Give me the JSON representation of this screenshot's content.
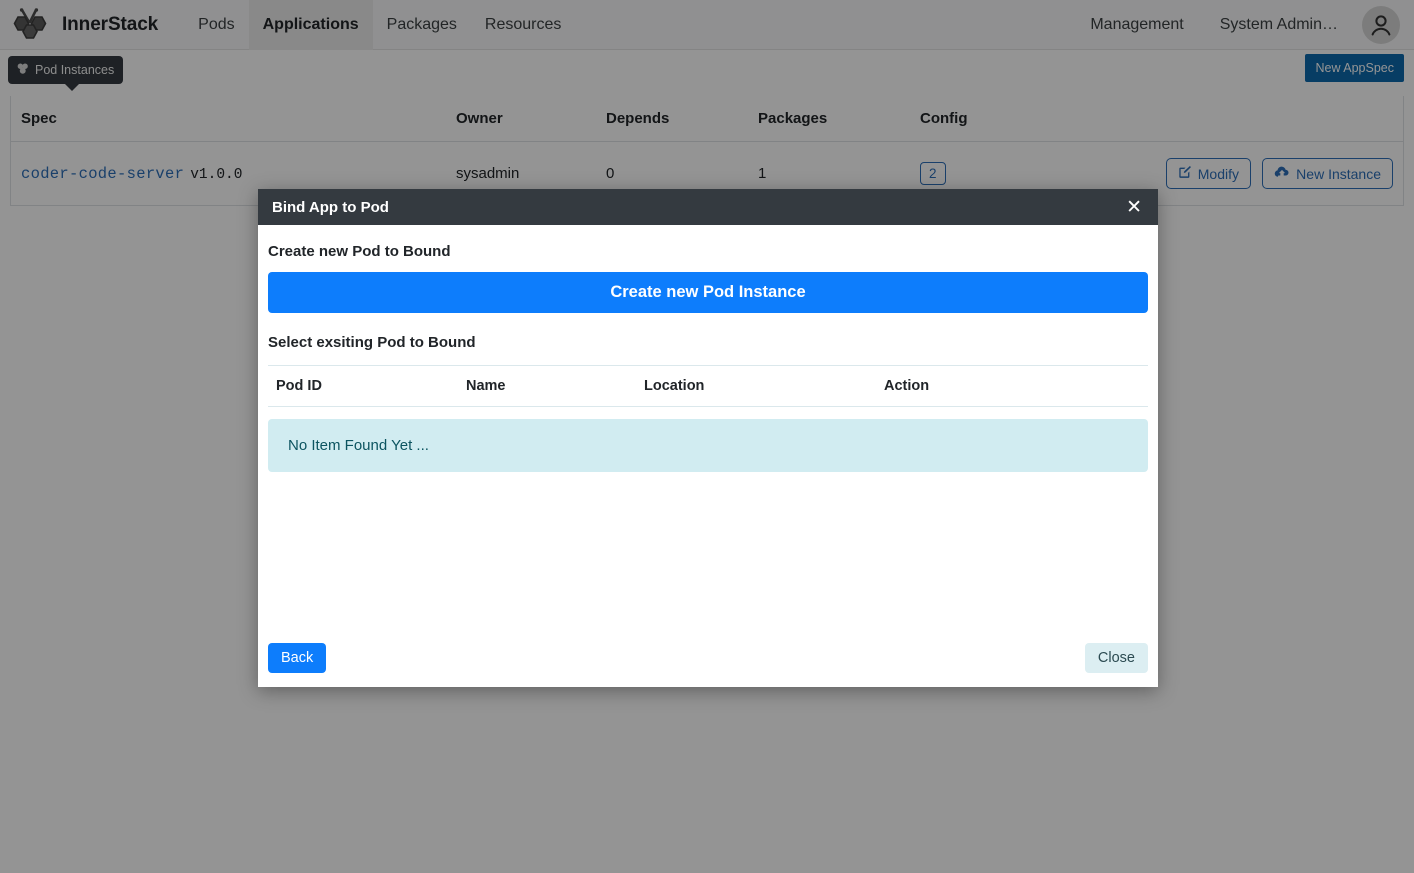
{
  "navbar": {
    "logo_icon": "bee-hexagon-logo-icon",
    "brand": "InnerStack",
    "links": [
      {
        "label": "Pods",
        "active": false
      },
      {
        "label": "Applications",
        "active": true
      },
      {
        "label": "Packages",
        "active": false
      },
      {
        "label": "Resources",
        "active": false
      }
    ],
    "right_links": [
      {
        "label": "Management"
      },
      {
        "label": "System Admin…"
      }
    ],
    "avatar_icon": "user-avatar-icon"
  },
  "subbar": {
    "tooltip_icon": "cubes-icon",
    "tooltip_label": "Pod Instances",
    "new_appspec_label": "New AppSpec"
  },
  "spec_table": {
    "headers": [
      "Spec",
      "Owner",
      "Depends",
      "Packages",
      "Config",
      ""
    ],
    "rows": [
      {
        "spec_name": "coder-code-server",
        "spec_version": "v1.0.0",
        "owner": "sysadmin",
        "depends": "0",
        "packages": "1",
        "config_count": "2",
        "modify_label": "Modify",
        "modify_icon": "pencil-square-icon",
        "new_instance_label": "New Instance",
        "new_instance_icon": "cloud-upload-icon"
      }
    ]
  },
  "modal": {
    "title": "Bind App to Pod",
    "close_icon": "close-icon",
    "create_section_label": "Create new Pod to Bound",
    "create_button_label": "Create new Pod Instance",
    "select_section_label": "Select exsiting Pod to Bound",
    "pod_table": {
      "headers": [
        "Pod ID",
        "Name",
        "Location",
        "Action"
      ],
      "rows": [],
      "empty_message": "No Item Found Yet ..."
    },
    "back_label": "Back",
    "close_label": "Close"
  },
  "colors": {
    "navbar_bg": "#f8f9fa",
    "active_tab_bg": "#ececec",
    "primary_blue": "#0d7dfc",
    "appspec_blue": "#0d6aad",
    "link_blue": "#2d6fb8",
    "modal_header_bg": "#343a40",
    "info_bg": "#d1ecf1",
    "info_text": "#0c5460",
    "backdrop": "rgba(0,0,0,0.42)"
  }
}
